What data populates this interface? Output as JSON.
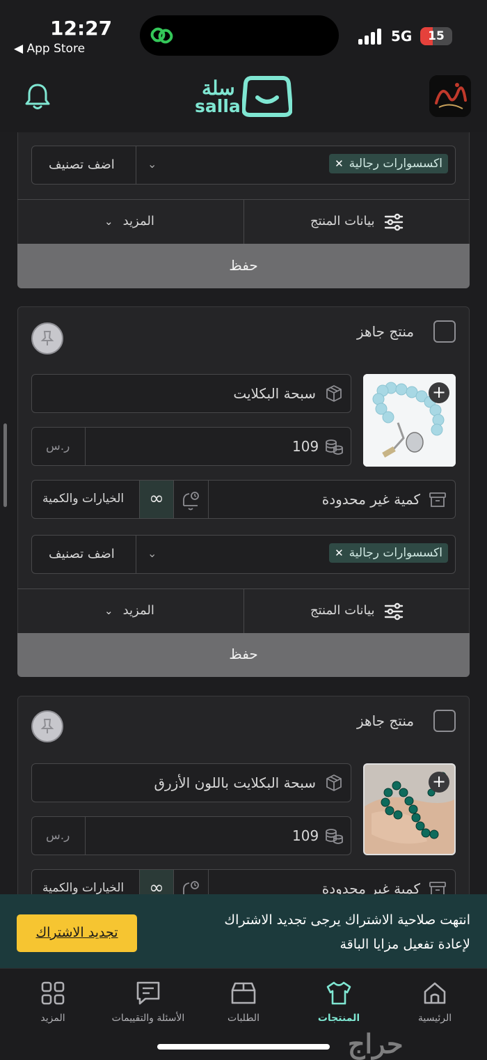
{
  "status_bar": {
    "time": "12:27",
    "back_label": "◀ App Store",
    "network": "5G",
    "battery": "15"
  },
  "header": {
    "logo_ar": "سلة",
    "logo_en": "salla",
    "accent_color": "#7fe6d2"
  },
  "top_card": {
    "category_chip": "اكسسوارات رجالية",
    "add_category": "اضف تصنيف",
    "product_data": "بيانات المنتج",
    "more": "المزيد",
    "save": "حفظ"
  },
  "products": [
    {
      "ready_label": "منتج جاهز",
      "name": "سبحة البكلايت",
      "price": "109",
      "currency": "ر.س",
      "quantity": "كمية غير محدودة",
      "options_qty": "الخيارات والكمية",
      "category_chip": "اكسسوارات رجالية",
      "add_category": "اضف تصنيف",
      "product_data": "بيانات المنتج",
      "more": "المزيد",
      "save": "حفظ"
    },
    {
      "ready_label": "منتج جاهز",
      "name": "سبحة البكلايت باللون الأزرق",
      "price": "109",
      "currency": "ر.س",
      "quantity": "كمية غير محدودة",
      "options_qty": "الخيارات والكمية"
    }
  ],
  "banner": {
    "line1": "انتهت صلاحية الاشتراك يرجى تجديد الاشتراك",
    "line2": "لإعادة تفعيل مزايا الباقة",
    "button": "تجديد الاشتراك"
  },
  "bottom_nav": {
    "items": [
      {
        "label": "الرئيسية",
        "icon": "home-icon"
      },
      {
        "label": "المنتجات",
        "icon": "shirt-icon",
        "active": true
      },
      {
        "label": "الطلبات",
        "icon": "box-icon"
      },
      {
        "label": "الأسئلة والتقييمات",
        "icon": "message-icon"
      },
      {
        "label": "المزيد",
        "icon": "grid-icon"
      }
    ]
  },
  "watermark": "حراج"
}
